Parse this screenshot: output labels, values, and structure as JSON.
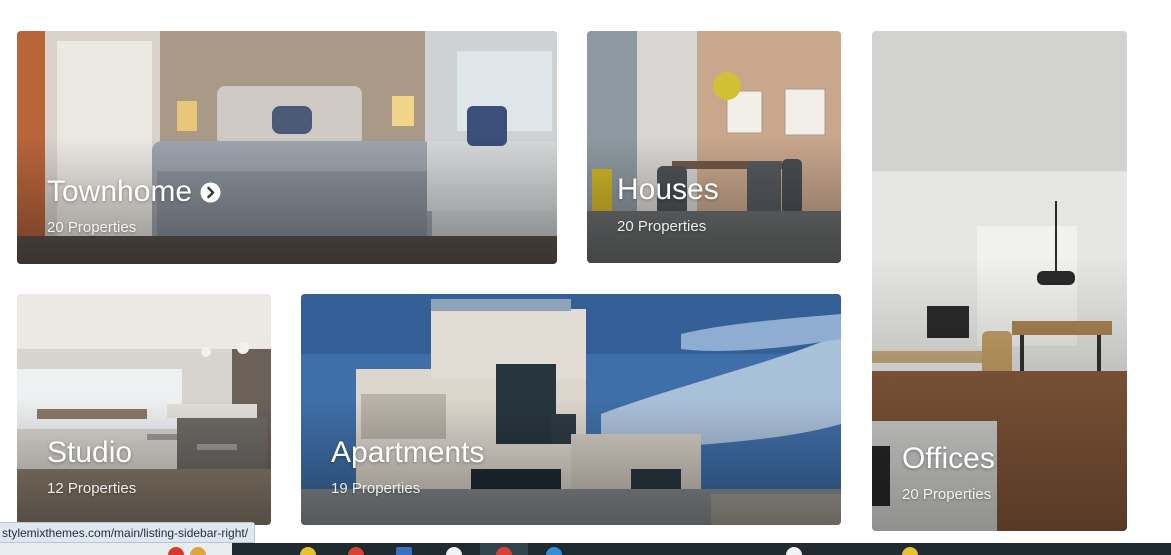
{
  "categories": [
    {
      "id": "townhome",
      "title": "Townhome",
      "count_label": "20 Properties",
      "has_arrow": true
    },
    {
      "id": "houses",
      "title": "Houses",
      "count_label": "20 Properties"
    },
    {
      "id": "offices",
      "title": "Offices",
      "count_label": "20 Properties"
    },
    {
      "id": "studio",
      "title": "Studio",
      "count_label": "12 Properties"
    },
    {
      "id": "apartments",
      "title": "Apartments",
      "count_label": "19 Properties"
    }
  ],
  "status_bar": {
    "url": "stylemixthemes.com/main/listing-sidebar-right/"
  },
  "icons": {
    "title_arrow": "chevron-right-circle-icon"
  },
  "colors": {
    "title_text": "#ffffff",
    "taskbar": "#1f2b31",
    "status_bg": "#dfe7ef"
  }
}
